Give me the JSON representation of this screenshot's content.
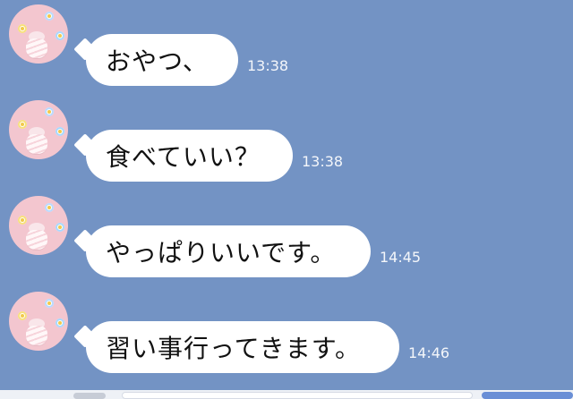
{
  "chat": {
    "messages": [
      {
        "text": "おやつ、",
        "time": "13:38"
      },
      {
        "text": "食べていい？",
        "time": "13:38"
      },
      {
        "text": "やっぱりいいです。",
        "time": "14:45"
      },
      {
        "text": "習い事行ってきます。",
        "time": "14:46"
      }
    ]
  },
  "colors": {
    "background": "#7393c4",
    "bubble": "#ffffff",
    "timestamp": "#ffffff"
  },
  "icons": {
    "avatar": "avatar-image"
  }
}
